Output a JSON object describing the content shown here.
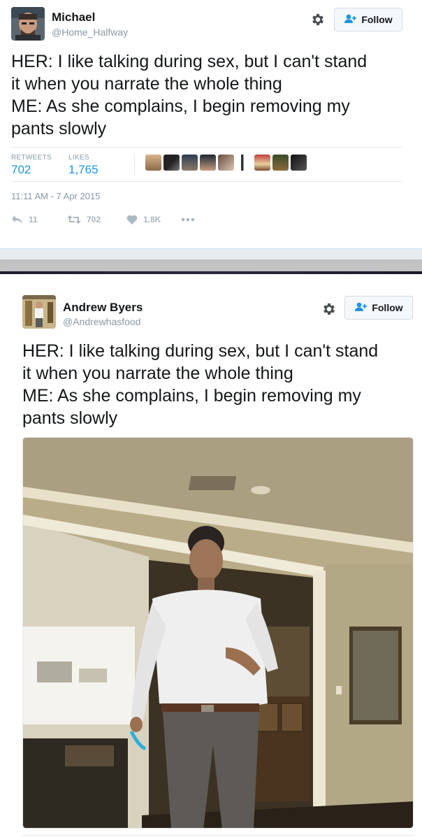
{
  "tweet1": {
    "name": "Michael",
    "handle": "@Home_Halfway",
    "follow_label": "Follow",
    "text": "HER: I like talking during sex, but I can't stand\nit when you narrate the whole thing\nME: As she complains, I begin removing my\npants slowly",
    "retweets_label": "RETWEETS",
    "retweets_value": "702",
    "likes_label": "LIKES",
    "likes_value": "1,765",
    "timestamp": "11:11 AM - 7 Apr 2015",
    "reply_count": "11",
    "retweet_count": "702",
    "like_count": "1.8K",
    "icons": [
      "gear-icon",
      "follow-person-icon",
      "reply-icon",
      "retweet-icon",
      "heart-icon",
      "more-icon"
    ]
  },
  "tweet2": {
    "name": "Andrew Byers",
    "handle": "@Andrewhasfood",
    "follow_label": "Follow",
    "text": "HER: I like talking during sex, but I can't stand\nit when you narrate the whole thing\nME: As she complains, I begin removing my\npants slowly",
    "icons": [
      "gear-icon",
      "follow-person-icon"
    ]
  },
  "colors": {
    "link_blue": "#1b95e0",
    "gray_text": "#8899a6",
    "action_gray": "#aab8c2",
    "border": "#e1e8ed"
  }
}
